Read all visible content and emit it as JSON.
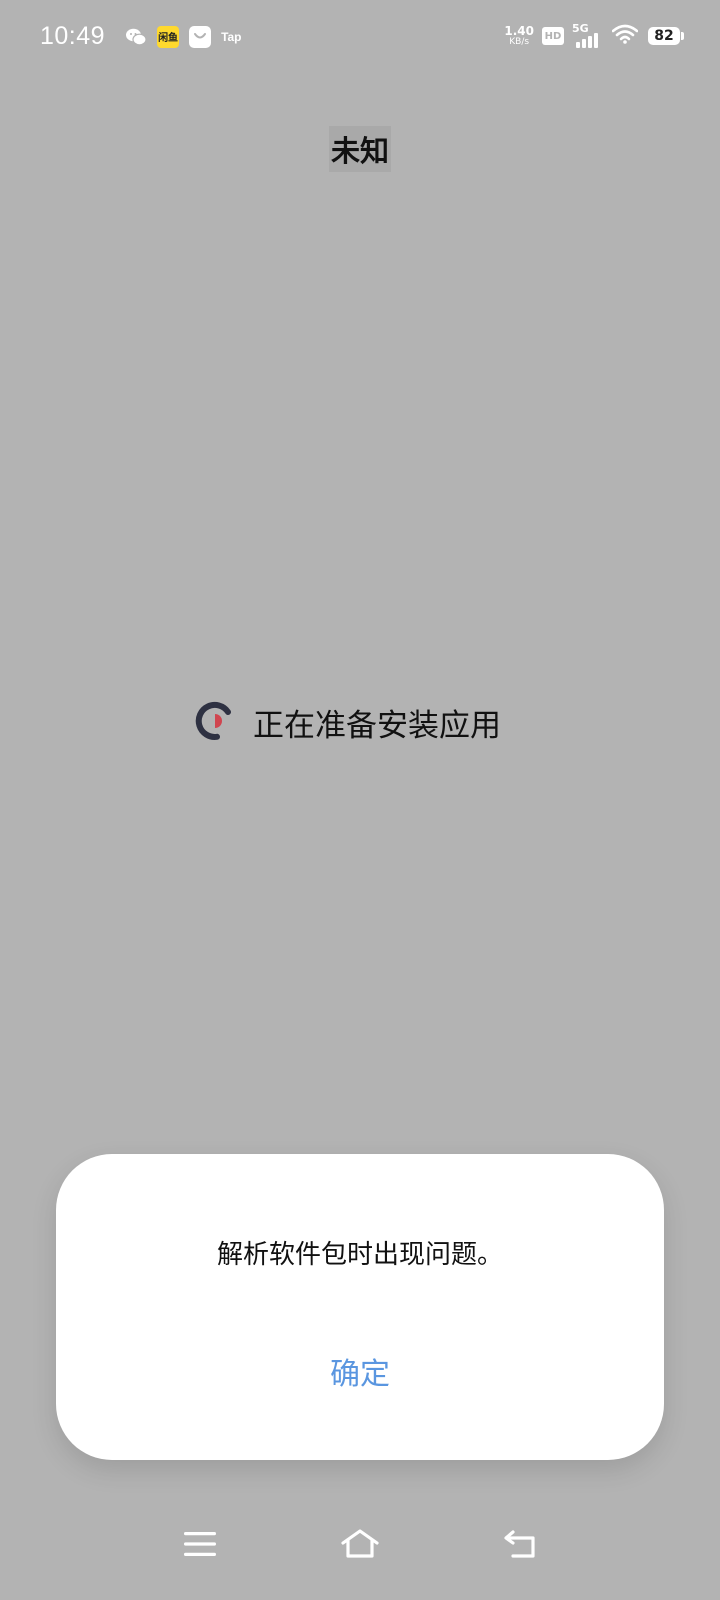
{
  "status_bar": {
    "time": "10:49",
    "notifications": [
      {
        "icon": "wechat-icon"
      },
      {
        "icon": "xianyu-app-icon",
        "text": "闲鱼"
      },
      {
        "icon": "shopping-bag-icon"
      },
      {
        "icon": "taptap-icon",
        "text": "Tap"
      }
    ],
    "net_speed_value": "1.40",
    "net_speed_unit": "KB/s",
    "hd_label": "HD",
    "network_type": "5G",
    "battery_level": "82"
  },
  "app": {
    "title": "未知",
    "preparing_text": "正在准备安装应用"
  },
  "dialog": {
    "message": "解析软件包时出现问题。",
    "ok_label": "确定"
  },
  "nav_bar": {
    "buttons": [
      {
        "icon": "menu-icon"
      },
      {
        "icon": "home-icon"
      },
      {
        "icon": "back-icon"
      }
    ]
  },
  "colors": {
    "background": "#b3b3b3",
    "dialog_bg": "#ffffff",
    "accent": "#5a96e0",
    "spinner_dark": "#2e3142",
    "spinner_red": "#d0454f"
  }
}
